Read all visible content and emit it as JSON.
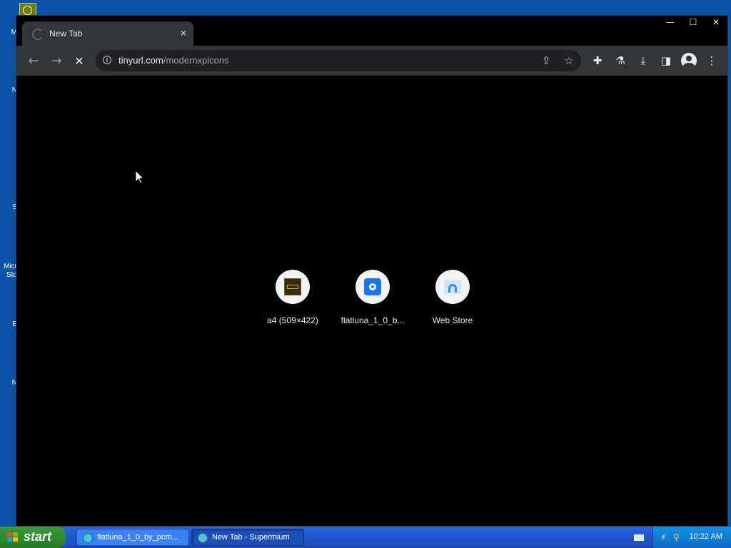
{
  "desktop": {
    "side_labels": [
      "M",
      "",
      "N",
      "S",
      "Micr",
      "Sto",
      "E",
      "N"
    ]
  },
  "browser": {
    "tab": {
      "title": "New Tab",
      "close_glyph": "×"
    },
    "window_controls": {
      "minimize": "—",
      "maximize": "☐",
      "close": "✕"
    },
    "toolbar": {
      "back_glyph": "←",
      "forward_glyph": "→",
      "stop_glyph": "✕",
      "url_host": "tinyurl.com",
      "url_path": "/modernxpicons",
      "info_glyph": "i",
      "share_glyph": "⇪",
      "bookmark_glyph": "☆",
      "extensions_glyph": "✚",
      "labs_glyph": "⚗",
      "download_glyph": "⤓",
      "sidepanel_glyph": "◨",
      "menu_glyph": "⋮"
    },
    "shortcuts": [
      {
        "label": "a4 (509×422)",
        "icon": "a4-thumbnail-icon"
      },
      {
        "label": "flatluna_1_0_b...",
        "icon": "flatluna-icon"
      },
      {
        "label": "Web Store",
        "icon": "web-store-icon"
      }
    ]
  },
  "taskbar": {
    "start_label": "start",
    "tasks": [
      {
        "label": "flatluna_1_0_by_pcm...",
        "active": false
      },
      {
        "label": "New Tab - Supermium",
        "active": true
      }
    ],
    "clock": "10:22 AM"
  },
  "colors": {
    "desktop_blue": "#0a52a6",
    "browser_frame": "#323639",
    "taskbar_blue": "#245edb",
    "start_green": "#2f8f2f"
  }
}
